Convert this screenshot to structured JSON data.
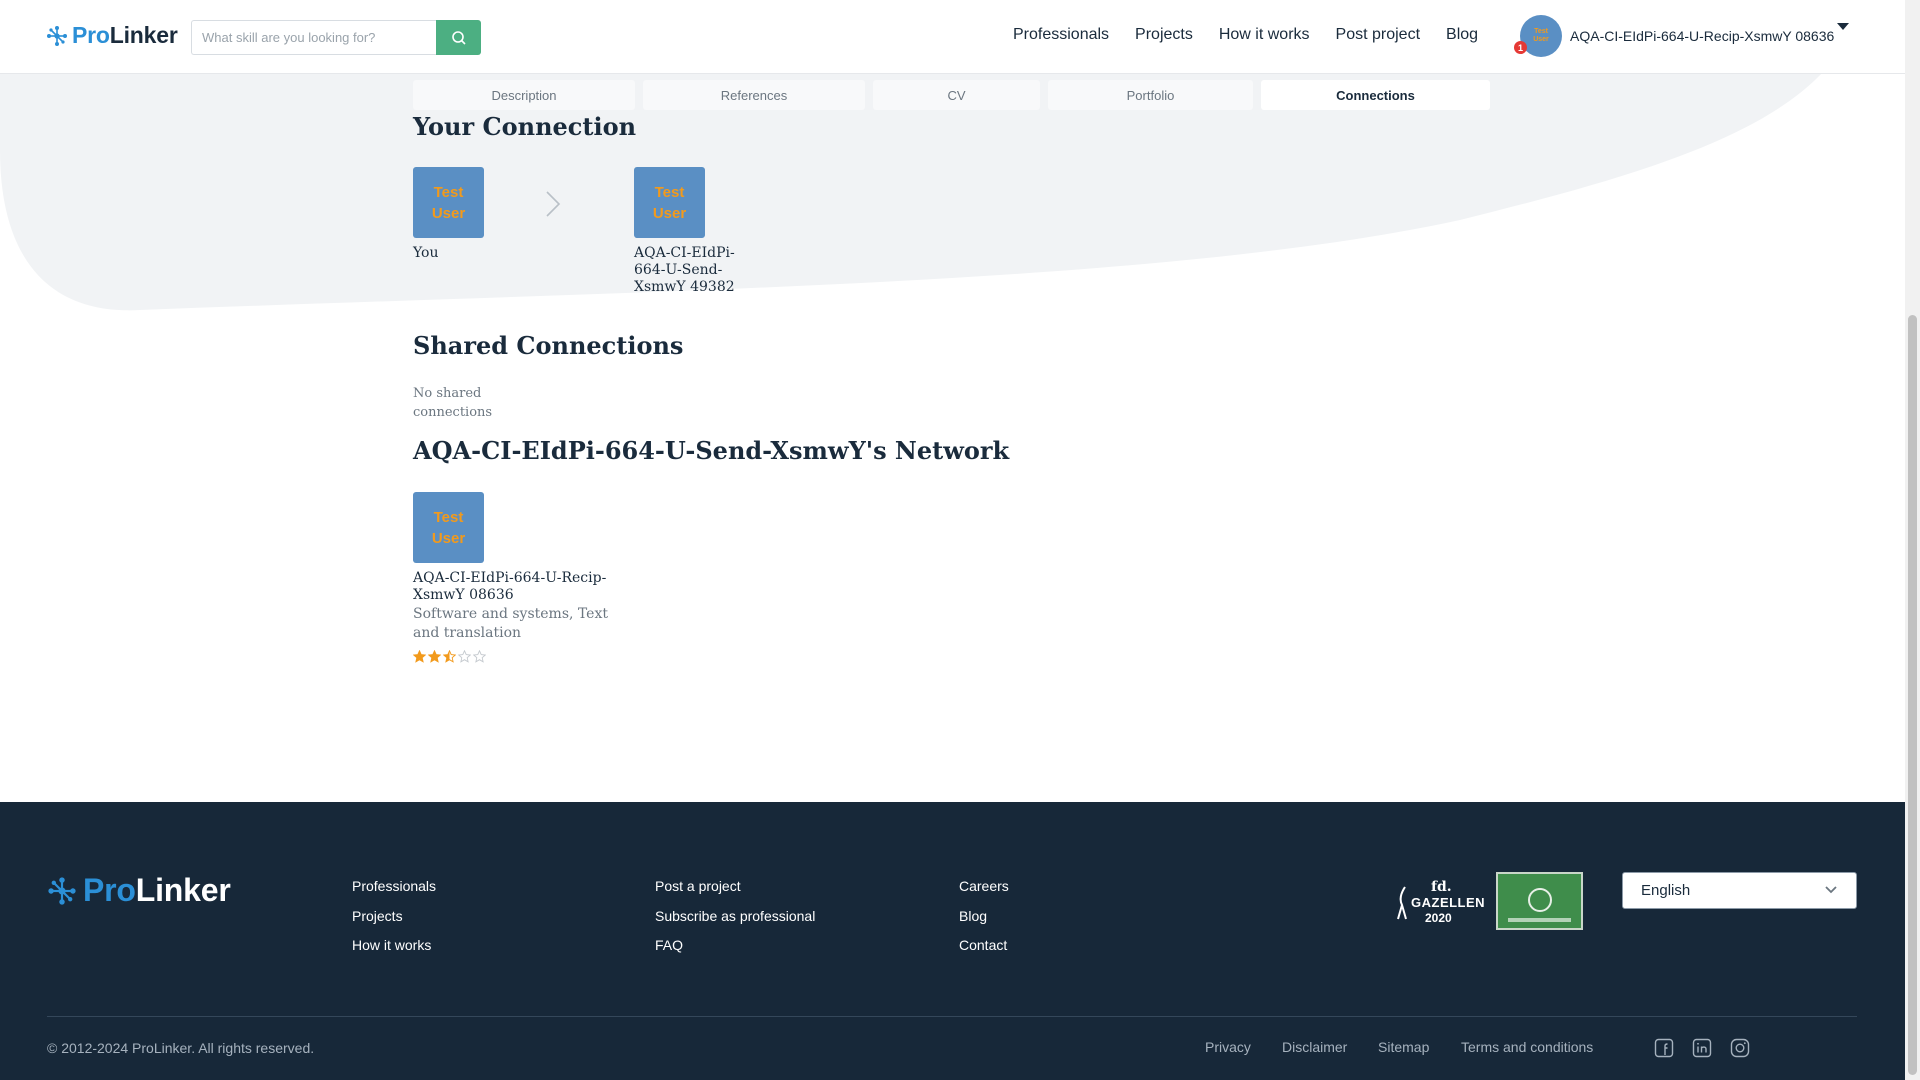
{
  "header": {
    "logo_pro": "Pro",
    "logo_linker": "Linker",
    "search_placeholder": "What skill are you looking for?",
    "nav": [
      "Professionals",
      "Projects",
      "How it works",
      "Post project",
      "Blog"
    ],
    "user_name": "AQA-CI-EIdPi-664-U-Recip-XsmwY 08636",
    "notification_count": "1",
    "avatar_text": "Test User"
  },
  "tabs": [
    {
      "label": "Description",
      "active": false
    },
    {
      "label": "References",
      "active": false
    },
    {
      "label": "CV",
      "active": false
    },
    {
      "label": "Portfolio",
      "active": false
    },
    {
      "label": "Connections",
      "active": true
    }
  ],
  "your_connection": {
    "title": "Your Connection",
    "you_avatar": "Test User",
    "you_label": "You",
    "other_avatar": "Test User",
    "other_name": "AQA-CI-EIdPi-664-U-Send-XsmwY 49382"
  },
  "shared": {
    "title": "Shared Connections",
    "empty_text": "No shared connections"
  },
  "network": {
    "title": "AQA-CI-EIdPi-664-U-Send-XsmwY's Network",
    "items": [
      {
        "avatar": "Test User",
        "name": "AQA-CI-EIdPi-664-U-Recip-XsmwY 08636",
        "skills": "Software and systems, Text and translation",
        "rating": 2.5,
        "rating_max": 5
      }
    ]
  },
  "footer": {
    "logo_pro": "Pro",
    "logo_linker": "Linker",
    "col1": [
      "Professionals",
      "Projects",
      "How it works"
    ],
    "col2": [
      "Post a project",
      "Subscribe as professional",
      "FAQ"
    ],
    "col3": [
      "Careers",
      "Blog",
      "Contact"
    ],
    "award1": {
      "line1": "fd.",
      "line2": "GAZELLEN",
      "line3": "2020"
    },
    "language": "English",
    "copyright": "© 2012-2024 ProLinker. All rights reserved.",
    "legal_links": [
      "Privacy",
      "Disclaimer",
      "Sitemap",
      "Terms and conditions"
    ],
    "social": [
      "facebook-icon",
      "linkedin-icon",
      "instagram-icon"
    ]
  },
  "colors": {
    "brand_blue": "#2b8fd6",
    "search_green": "#4caf82",
    "avatar_blue": "#5a8fc4",
    "avatar_text": "#f29a1c",
    "footer_bg": "#172839",
    "star": "#f29a1c"
  }
}
